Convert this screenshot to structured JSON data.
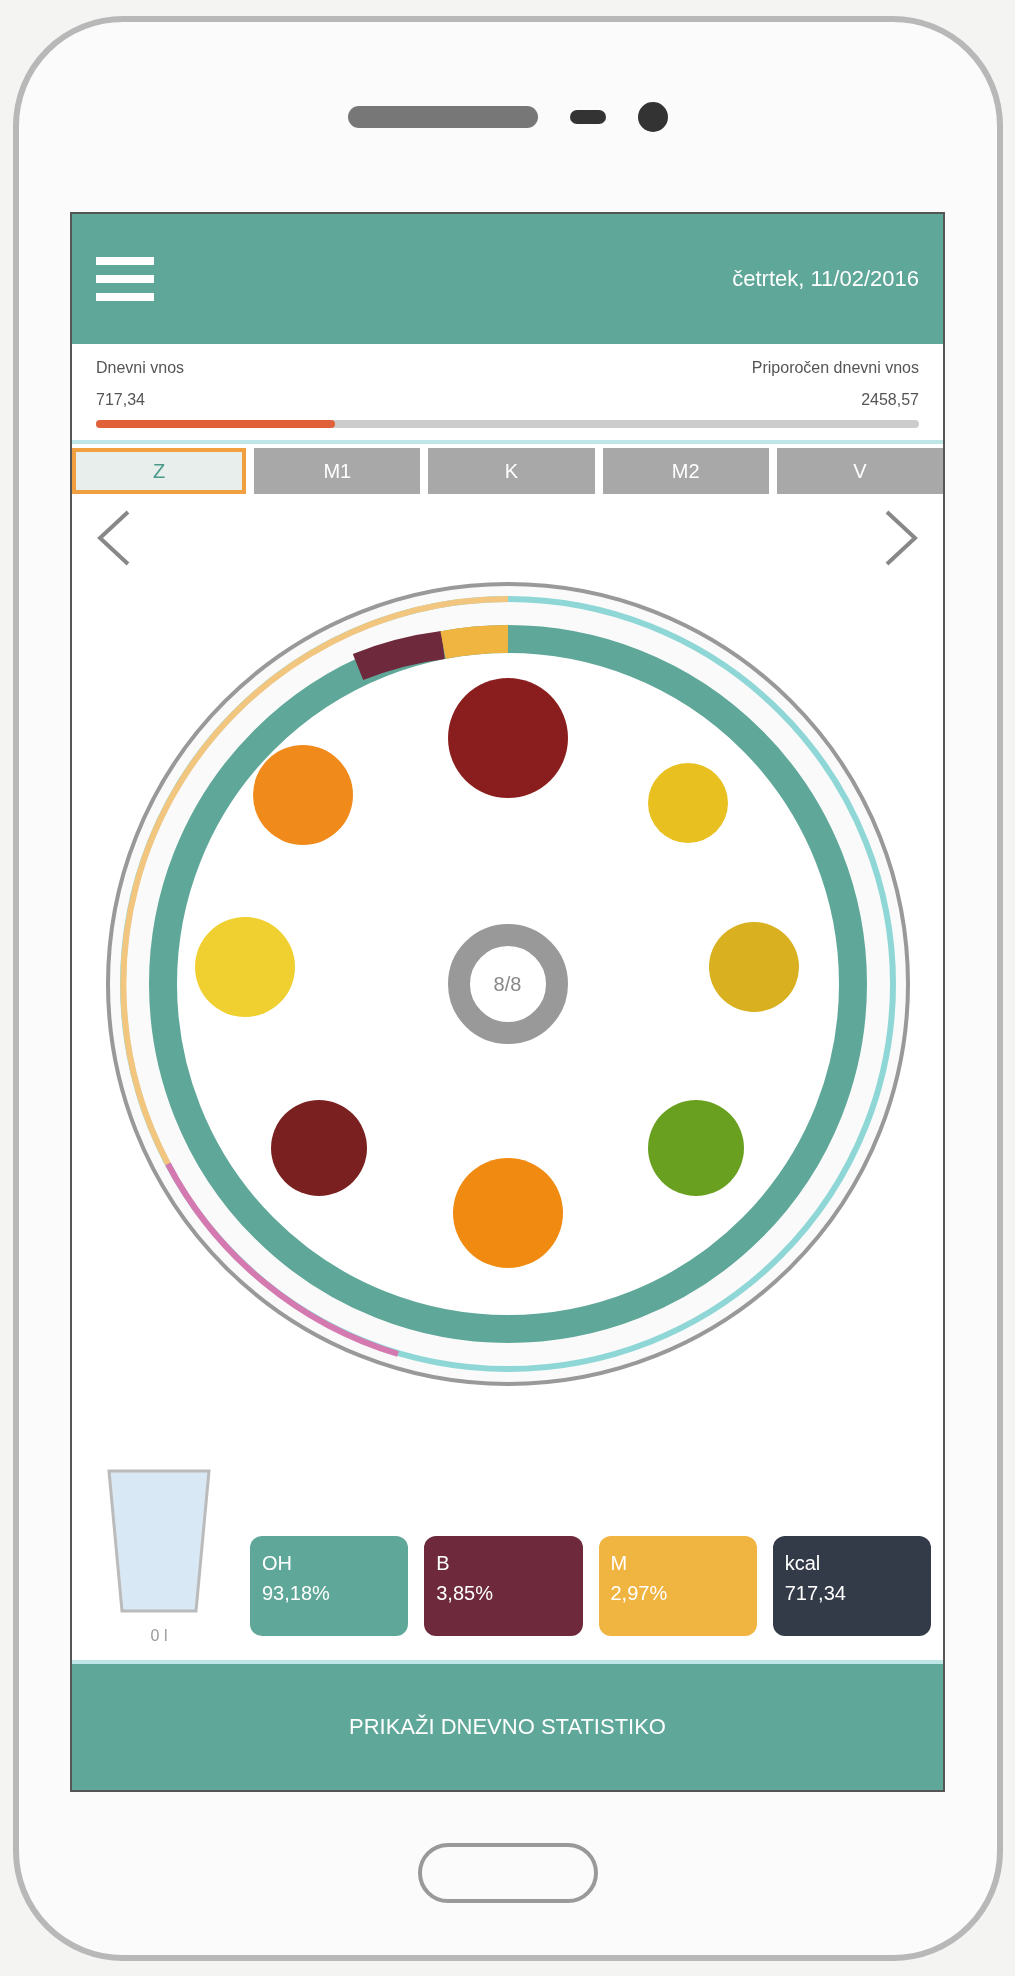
{
  "header": {
    "date": "četrtek, 11/02/2016"
  },
  "intake": {
    "label": "Dnevni vnos",
    "value": "717,34",
    "recommended_label": "Priporočen dnevni vnos",
    "recommended_value": "2458,57",
    "level": 0.29
  },
  "meals": [
    {
      "label": "Z",
      "selected": true
    },
    {
      "label": "M1",
      "selected": false
    },
    {
      "label": "K",
      "selected": false
    },
    {
      "label": "M2",
      "selected": false
    },
    {
      "label": "V",
      "selected": false
    }
  ],
  "plate": {
    "center": "8/8"
  },
  "water": {
    "label": "0 l"
  },
  "nutrients": [
    {
      "label": "OH",
      "value": "93,18%",
      "color": "#5fa899"
    },
    {
      "label": "B",
      "value": "3,85%",
      "color": "#6e2a3c"
    },
    {
      "label": "M",
      "value": "2,97%",
      "color": "#f0b440"
    },
    {
      "label": "kcal",
      "value": "717,34",
      "color": "#333a48"
    }
  ],
  "footer_button": "PRIKAŽI DNEVNO STATISTIKO"
}
